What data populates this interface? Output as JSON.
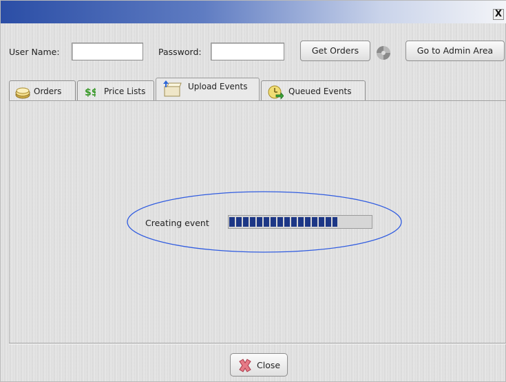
{
  "window": {
    "close_glyph": "X"
  },
  "login": {
    "username_label": "User Name:",
    "username_value": "",
    "password_label": "Password:",
    "password_value": "",
    "get_orders_label": "Get Orders",
    "admin_label": "Go to Admin Area"
  },
  "tabs": [
    {
      "label": "Orders",
      "icon": "orders-icon",
      "active": false
    },
    {
      "label": "Price Lists",
      "icon": "price-lists-icon",
      "active": false
    },
    {
      "label": "Upload Events",
      "icon": "upload-events-icon",
      "active": true
    },
    {
      "label": "Queued Events",
      "icon": "queued-events-icon",
      "active": false
    }
  ],
  "progress": {
    "label": "Creating event",
    "fraction": 0.76,
    "bar_color": "#1d3786",
    "highlight_color": "#2f5be0"
  },
  "footer": {
    "close_label": "Close"
  },
  "colors": {
    "titlebar_start": "#2b4ea6",
    "titlebar_end": "#f4f5f8"
  }
}
